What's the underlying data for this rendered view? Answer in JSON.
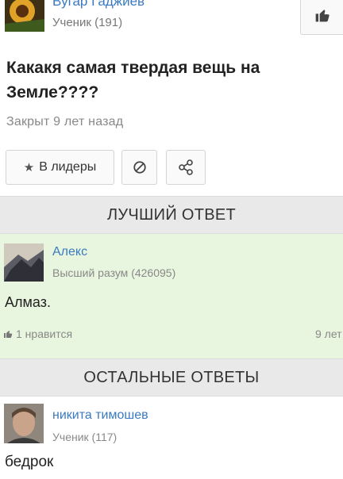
{
  "question": {
    "author": {
      "name": "Вугар Гаджиев",
      "rank": "Ученик (191)"
    },
    "title": "Какакя самая твердая вещь на Земле????",
    "status": "Закрыт 9 лет назад",
    "buttons": {
      "leaders": "В лидеры"
    }
  },
  "best_answer": {
    "header": "ЛУЧШИЙ ОТВЕТ",
    "author": {
      "name": "Алекс",
      "rank": "Высший разум (426095)"
    },
    "text": "Алмаз.",
    "likes": "1 нравится",
    "ago": "9 лет"
  },
  "other_answers": {
    "header": "ОСТАЛЬНЫЕ ОТВЕТЫ",
    "items": [
      {
        "author": {
          "name": "никита тимошев",
          "rank": "Ученик (117)"
        },
        "text": "бедрок"
      }
    ]
  },
  "colors": {
    "link": "#3a7ac0",
    "best_bg": "#e9f6df",
    "section_bg": "#e9e9e9",
    "muted": "#888888"
  }
}
